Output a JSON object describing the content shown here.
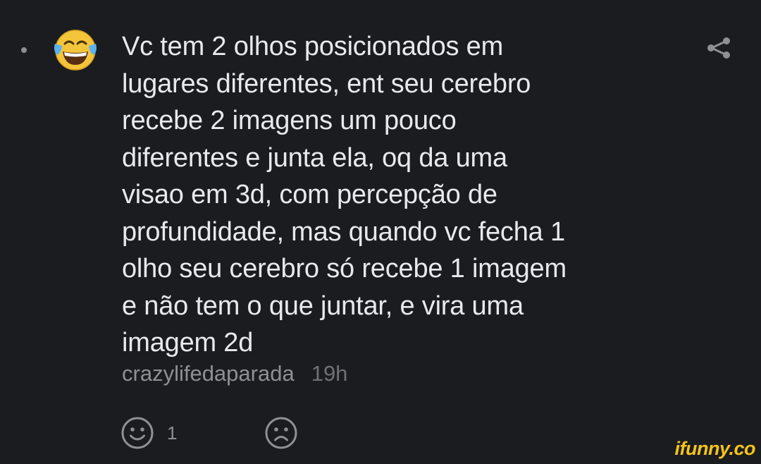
{
  "comment": {
    "lines": [
      "Vc tem 2 olhos posicionados em",
      "lugares diferentes, ent seu cerebro",
      "recebe 2 imagens um pouco",
      "diferentes e junta ela, oq da uma",
      "visao em 3d, com percepção de",
      "profundidade, mas quando vc fecha 1",
      "olho seu cerebro só recebe 1 imagem",
      "e não tem o que juntar, e vira uma",
      "imagem 2d"
    ],
    "username": "crazylifedaparada",
    "time": "19h",
    "avatar_icon": "face-with-tears-of-joy-icon"
  },
  "reactions": {
    "smile": {
      "icon": "smile-icon",
      "count": "1"
    },
    "sad": {
      "icon": "sad-face-icon"
    }
  },
  "share_icon": "share-icon",
  "watermark": "ifunny.co",
  "colors": {
    "background": "#1b1c20",
    "text": "#e9e9ec",
    "muted": "#8e9096",
    "watermark": "#f5c416"
  }
}
